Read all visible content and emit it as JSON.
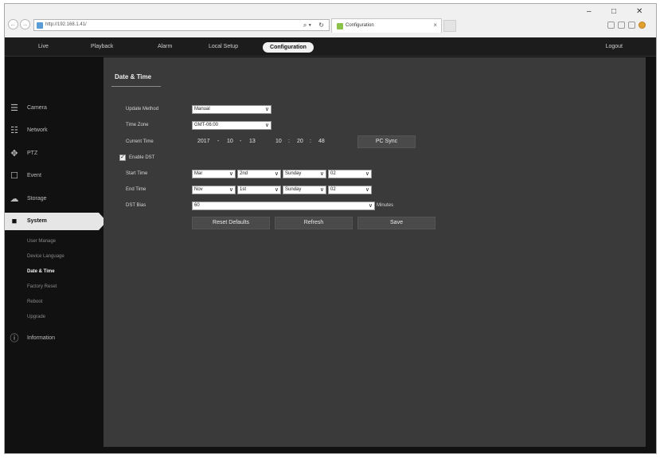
{
  "browser": {
    "url": "http://192.168.1.41/",
    "tab_title": "Configuration",
    "search_glyph": "⌕ ▾",
    "reload_glyph": "↻",
    "back_glyph": "←",
    "forward_glyph": "→",
    "tab_close_glyph": "×",
    "minimize_glyph": "–",
    "maximize_glyph": "□",
    "close_glyph": "✕"
  },
  "topnav": {
    "items": [
      "Live",
      "Playback",
      "Alarm",
      "Local Setup"
    ],
    "active": "Configuration",
    "logout": "Logout"
  },
  "sidebar": {
    "items": [
      {
        "label": "Camera",
        "icon": "camera-icon",
        "glyph": "☰"
      },
      {
        "label": "Network",
        "icon": "network-icon",
        "glyph": "☷"
      },
      {
        "label": "PTZ",
        "icon": "ptz-icon",
        "glyph": "✥"
      },
      {
        "label": "Event",
        "icon": "event-icon",
        "glyph": "☐"
      },
      {
        "label": "Storage",
        "icon": "storage-icon",
        "glyph": "☁"
      },
      {
        "label": "System",
        "icon": "system-icon",
        "glyph": "■"
      },
      {
        "label": "Information",
        "icon": "information-icon",
        "glyph": "ⓘ"
      }
    ],
    "system_sub": [
      "User Manage",
      "Device Language",
      "Date & Time",
      "Factory Reset",
      "Reboot",
      "Upgrade"
    ]
  },
  "content": {
    "title": "Date & Time",
    "update_method": {
      "label": "Update Method",
      "value": "Manual"
    },
    "time_zone": {
      "label": "Time Zone",
      "value": "GMT-06:00"
    },
    "current_time": {
      "label": "Current Time",
      "year": "2017",
      "month": "10",
      "day": "13",
      "hour": "10",
      "minute": "20",
      "second": "48",
      "date_sep": "-",
      "time_sep": ":"
    },
    "pc_sync": "PC Sync",
    "enable_dst": {
      "label": "Enable DST",
      "checked": true,
      "check_glyph": "✓"
    },
    "start_time": {
      "label": "Start Time",
      "month": "Mar",
      "week": "2nd",
      "day": "Sunday",
      "hour": "02"
    },
    "end_time": {
      "label": "End Time",
      "month": "Nov",
      "week": "1st",
      "day": "Sunday",
      "hour": "02"
    },
    "dst_bias": {
      "label": "DST Bias",
      "value": "60",
      "unit": "Minutes"
    },
    "buttons": {
      "reset": "Reset Defaults",
      "refresh": "Refresh",
      "save": "Save"
    },
    "chevron_glyph": "∨"
  }
}
